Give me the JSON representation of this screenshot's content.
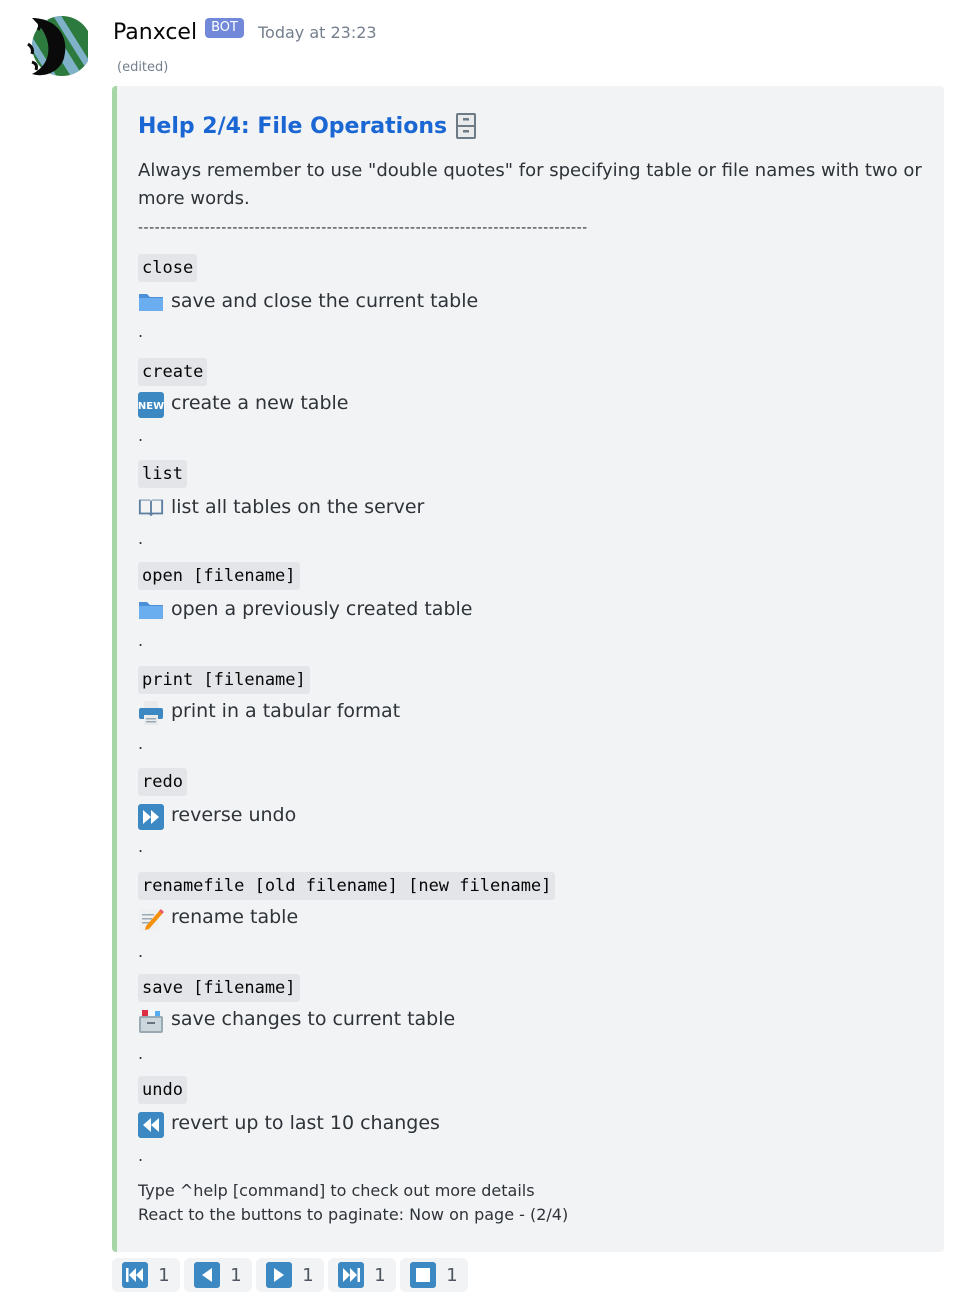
{
  "message": {
    "username": "Panxcel",
    "bot_tag": "BOT",
    "timestamp": "Today at 23:23",
    "edited": "(edited)"
  },
  "embed": {
    "title": "Help 2/4: File Operations",
    "title_icon": "file-cabinet-icon",
    "description": "Always remember to use \"double quotes\" for specifying table or file names with two or more words.",
    "separator": "---------------------------------------------------------------------------------",
    "commands": [
      {
        "command": "close",
        "icon": "folder-icon",
        "description": "save and close the current table",
        "dot": "."
      },
      {
        "command": "create",
        "icon": "new-icon",
        "description": "create a new table",
        "dot": "."
      },
      {
        "command": "list",
        "icon": "book-icon",
        "description": "list all tables on the server",
        "dot": "."
      },
      {
        "command": "open [filename]",
        "icon": "folder-icon",
        "description": "open a previously created table",
        "dot": "."
      },
      {
        "command": "print [filename]",
        "icon": "printer-icon",
        "description": "print in a tabular format",
        "dot": "."
      },
      {
        "command": "redo",
        "icon": "fast-forward-icon",
        "description": "reverse undo",
        "dot": "."
      },
      {
        "command": "renamefile [old filename] [new filename]",
        "icon": "memo-icon",
        "description": "rename table",
        "dot": "."
      },
      {
        "command": "save [filename]",
        "icon": "card-file-box-icon",
        "description": "save changes to current table",
        "dot": "."
      },
      {
        "command": "undo",
        "icon": "rewind-icon",
        "description": "revert up to last 10 changes",
        "dot": "."
      }
    ],
    "footer_line1": "Type ^help [command] to check out more details",
    "footer_line2": "React to the buttons to paginate: Now on page - (2/4)",
    "accent_color": "#a6d5a6",
    "title_color": "#1a67d4"
  },
  "reactions": [
    {
      "icon": "first-page-icon",
      "count": "1"
    },
    {
      "icon": "previous-page-icon",
      "count": "1"
    },
    {
      "icon": "next-page-icon",
      "count": "1"
    },
    {
      "icon": "last-page-icon",
      "count": "1"
    },
    {
      "icon": "stop-icon",
      "count": "1"
    }
  ]
}
